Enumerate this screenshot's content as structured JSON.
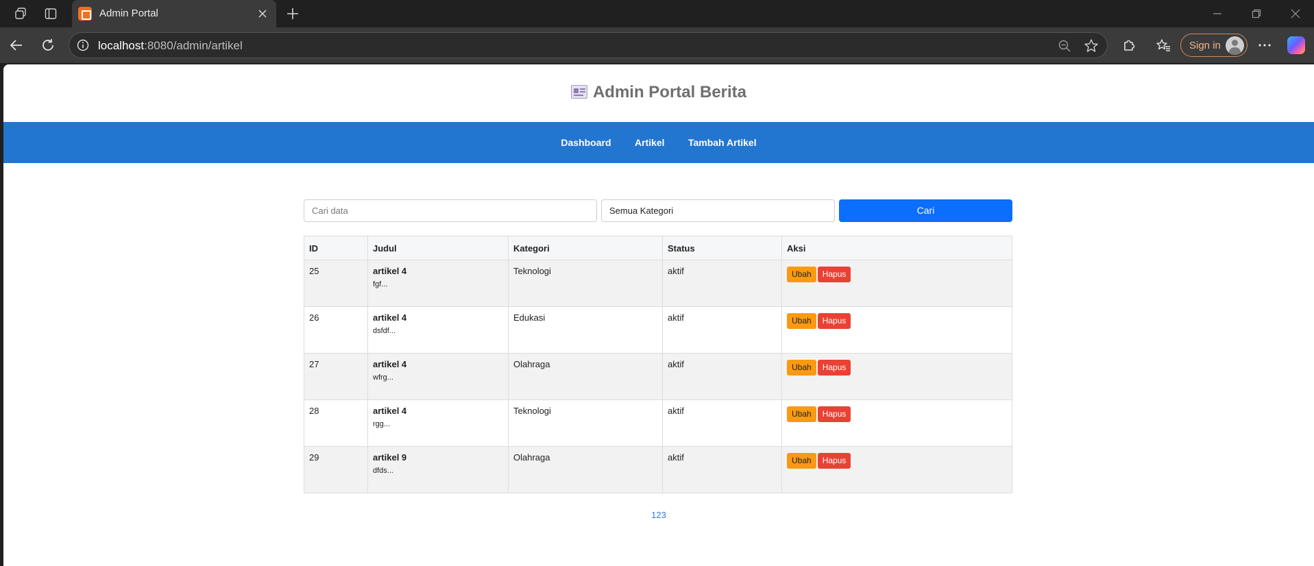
{
  "browser": {
    "tab_title": "Admin Portal",
    "url_host": "localhost",
    "url_rest": ":8080/admin/artikel",
    "signin_label": "Sign in"
  },
  "site": {
    "title": "Admin Portal Berita",
    "menu": [
      "Dashboard",
      "Artikel",
      "Tambah Artikel"
    ]
  },
  "search": {
    "placeholder": "Cari data",
    "category_value": "Semua Kategori",
    "button_label": "Cari"
  },
  "table": {
    "headers": [
      "ID",
      "Judul",
      "Kategori",
      "Status",
      "Aksi"
    ],
    "edit_label": "Ubah",
    "delete_label": "Hapus",
    "rows": [
      {
        "id": "25",
        "title": "artikel 4",
        "snippet": "fgf...",
        "category": "Teknologi",
        "status": "aktif"
      },
      {
        "id": "26",
        "title": "artikel 4",
        "snippet": "dsfdf...",
        "category": "Edukasi",
        "status": "aktif"
      },
      {
        "id": "27",
        "title": "artikel 4",
        "snippet": "wfrg...",
        "category": "Olahraga",
        "status": "aktif"
      },
      {
        "id": "28",
        "title": "artikel 4",
        "snippet": "rgg...",
        "category": "Teknologi",
        "status": "aktif"
      },
      {
        "id": "29",
        "title": "artikel 9",
        "snippet": "dfds...",
        "category": "Olahraga",
        "status": "aktif"
      }
    ]
  },
  "pagination": {
    "pages": [
      "1",
      "2",
      "3"
    ]
  },
  "colors": {
    "nav_blue": "#2276cf",
    "primary_button": "#0b6efd",
    "edit_button": "#f99a10",
    "delete_button": "#e94235",
    "link": "#2f7bd9"
  }
}
